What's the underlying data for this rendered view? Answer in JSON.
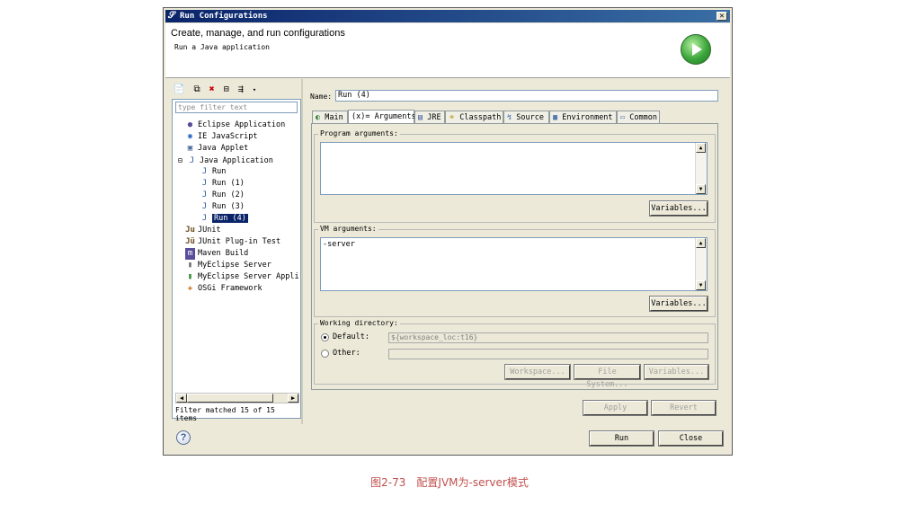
{
  "window": {
    "title": "Run Configurations",
    "close": "✕"
  },
  "header": {
    "title": "Create, manage, and run configurations",
    "subtitle": "Run a Java application"
  },
  "left": {
    "filter_placeholder": "type filter text",
    "tree": [
      {
        "label": "Eclipse Application",
        "icon": "eclipse-icon",
        "glyph": "●"
      },
      {
        "label": "IE JavaScript",
        "icon": "globe-icon",
        "glyph": "◉"
      },
      {
        "label": "Java Applet",
        "icon": "applet-icon",
        "glyph": "▣"
      },
      {
        "label": "Java Application",
        "icon": "java-app-icon",
        "glyph": "J"
      },
      {
        "label": "Run",
        "icon": "java-run-icon",
        "glyph": "J"
      },
      {
        "label": "Run (1)",
        "icon": "java-run-icon",
        "glyph": "J"
      },
      {
        "label": "Run (2)",
        "icon": "java-run-icon",
        "glyph": "J"
      },
      {
        "label": "Run (3)",
        "icon": "java-run-icon",
        "glyph": "J"
      },
      {
        "label": "Run (4)",
        "icon": "java-run-icon",
        "glyph": "J"
      },
      {
        "label": "JUnit",
        "icon": "junit-icon",
        "glyph": "Ju"
      },
      {
        "label": "JUnit Plug-in Test",
        "icon": "junit-plugin-icon",
        "glyph": "Jü"
      },
      {
        "label": "Maven Build",
        "icon": "maven-icon",
        "glyph": "m"
      },
      {
        "label": "MyEclipse Server",
        "icon": "server-icon",
        "glyph": "▮"
      },
      {
        "label": "MyEclipse Server Appli",
        "icon": "server-app-icon",
        "glyph": "▮"
      },
      {
        "label": "OSGi Framework",
        "icon": "osgi-icon",
        "glyph": "✚"
      }
    ],
    "status": "Filter matched 15 of 15 items"
  },
  "right": {
    "name_label": "Name:",
    "name_value": "Run (4)",
    "tabs": [
      "Main",
      "(x)= Arguments",
      "JRE",
      "Classpath",
      "Source",
      "Environment",
      "Common"
    ],
    "program_args_label": "Program arguments:",
    "program_args_value": "",
    "variables_label": "Variables...",
    "vm_args_label": "VM arguments:",
    "vm_args_value": "-server",
    "workdir_label": "Working directory:",
    "default_label": "Default:",
    "default_value": "${workspace_loc:t16}",
    "other_label": "Other:",
    "workspace_btn": "Workspace...",
    "filesystem_btn": "File System...",
    "apply_btn": "Apply",
    "revert_btn": "Revert"
  },
  "footer": {
    "run_btn": "Run",
    "close_btn": "Close",
    "help": "?"
  },
  "caption": "图2-73　配置JVM为-server模式"
}
